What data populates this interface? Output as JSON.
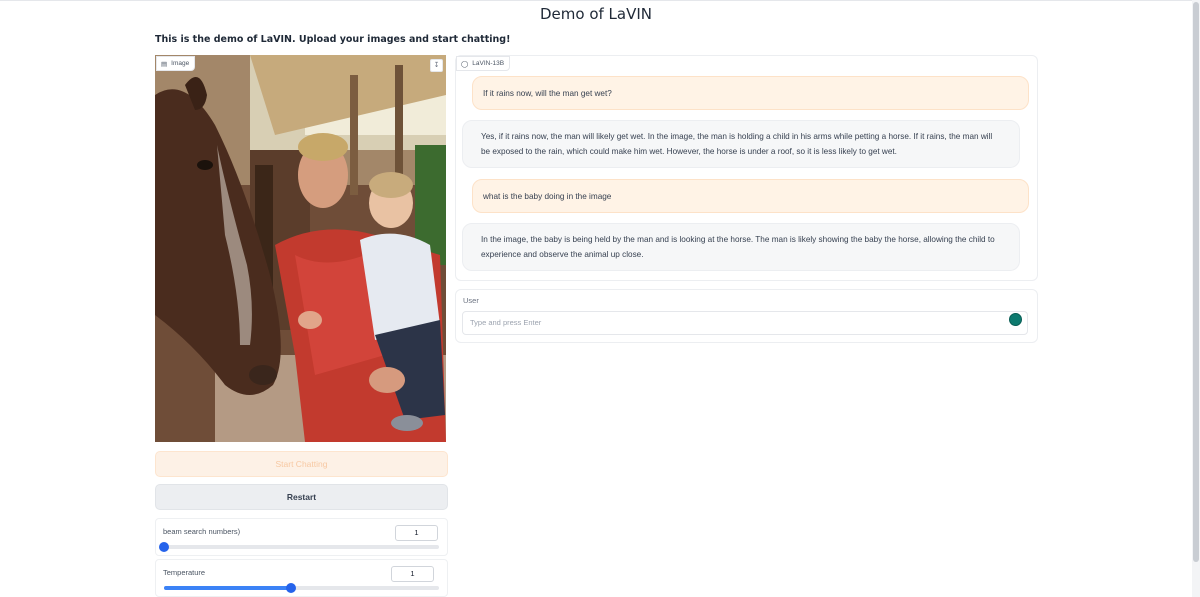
{
  "page": {
    "title": "Demo of LaVIN",
    "subtitle": "This is the demo of LaVIN. Upload your images and start chatting!"
  },
  "image_panel": {
    "label": "Image",
    "label_icon": "image-icon",
    "download_icon": "download-icon"
  },
  "buttons": {
    "start_label": "Start Chatting",
    "restart_label": "Restart"
  },
  "sliders": [
    {
      "label": "beam search numbers)",
      "value": "1",
      "level": 0.0
    },
    {
      "label": "Temperature",
      "value": "1",
      "level": 0.46
    }
  ],
  "chat": {
    "label": "LaVIN-13B",
    "label_icon": "chat-icon",
    "messages": [
      {
        "role": "user",
        "text": "If it rains now, will the man get wet?"
      },
      {
        "role": "bot",
        "text": "Yes, if it rains now, the man will likely get wet. In the image, the man is holding a child in his arms while petting a horse. If it rains, the man will be exposed to the rain, which could make him wet. However, the horse is under a roof, so it is less likely to get wet."
      },
      {
        "role": "user",
        "text": "what is the baby doing in the image"
      },
      {
        "role": "bot",
        "text": "In the image, the baby is being held by the man and is looking at the horse. The man is likely showing the baby the horse, allowing the child to experience and observe the animal up close."
      }
    ]
  },
  "input": {
    "label": "User",
    "placeholder": "Type and press Enter",
    "addon_icon": "grammarly-icon"
  },
  "colors": {
    "accent": "#3b82f6",
    "user_bubble": "#fff3e6",
    "bot_bubble": "#f6f7f8",
    "start_button": "#fdf1e6"
  }
}
